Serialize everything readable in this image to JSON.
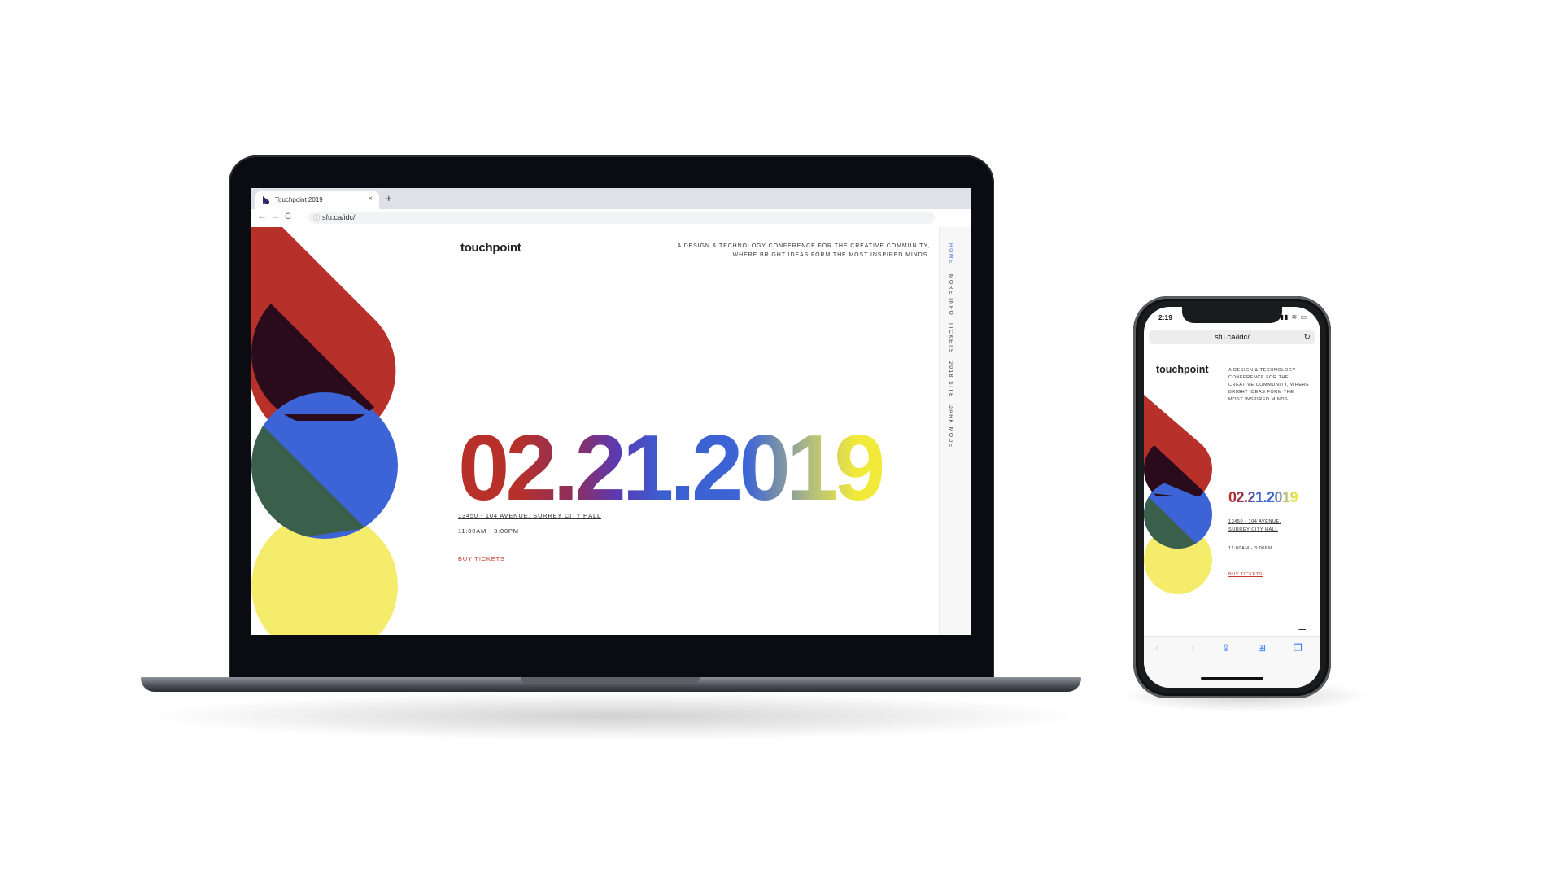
{
  "laptop": {
    "browser": {
      "tab_title": "Touchpoint 2019",
      "tab_close": "×",
      "new_tab": "+",
      "back": "←",
      "forward": "→",
      "reload": "C",
      "url": "sfu.ca/idc/"
    },
    "page": {
      "brand": "touchpoint",
      "tagline_line1": "A DESIGN & TECHNOLOGY CONFERENCE FOR THE CREATIVE COMMUNITY,",
      "tagline_line2": "WHERE BRIGHT IDEAS FORM THE MOST INSPIRED MINDS.",
      "date": "02.21.2019",
      "address": "13450 - 104 AVENUE, SURREY CITY HALL",
      "time": "11:00AM - 3:00PM",
      "cta": "BUY TICKETS",
      "sidebar": [
        "HOME",
        "MORE INFO",
        "TICKETS",
        "2018 SITE",
        "DARK MODE"
      ]
    }
  },
  "phone": {
    "status_time": "2:19",
    "url": "sfu.ca/idc/",
    "brand": "touchpoint",
    "tagline": "A DESIGN & TECHNOLOGY CONFERENCE FOR THE CREATIVE COMMUNITY, WHERE BRIGHT IDEAS FORM THE MOST INSPIRED MINDS.",
    "date": "02.21.2019",
    "address": "13450 - 104 AVENUE, SURREY CITY HALL",
    "time": "11:00AM - 3:00PM",
    "cta": "BUY TICKETS"
  },
  "colors": {
    "red": "#b7302a",
    "blue": "#3d64d6",
    "green": "#3a5f4b",
    "yellow": "#f4ec6a",
    "dark_overlap": "#2a0b1c",
    "link_red": "#c23a2f"
  }
}
